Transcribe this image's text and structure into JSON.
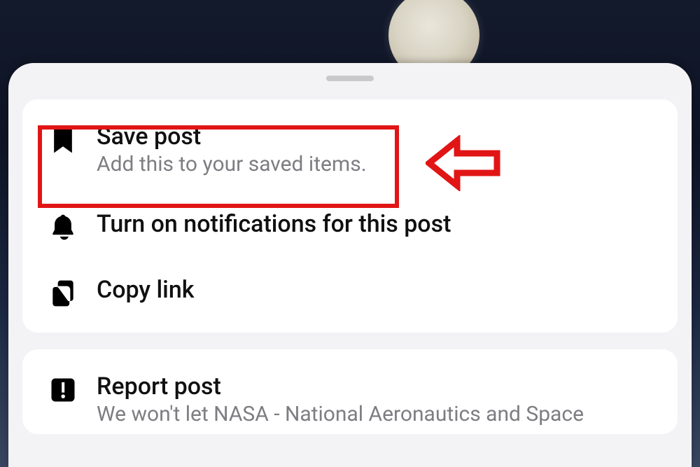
{
  "sheet": {
    "items": [
      {
        "title": "Save post",
        "subtitle": "Add this to your saved items."
      },
      {
        "title": "Turn on notifications for this post"
      },
      {
        "title": "Copy link"
      }
    ],
    "items2": [
      {
        "title": "Report post",
        "subtitle": "We won't let NASA - National Aeronautics and Space"
      }
    ]
  },
  "annotation": {
    "color": "#e11515"
  }
}
